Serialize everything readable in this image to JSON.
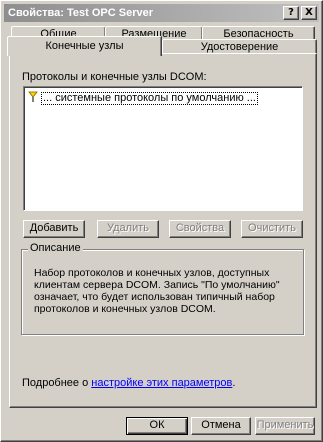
{
  "window": {
    "title": "Свойства: Test OPC Server",
    "help_button": "?",
    "close_button": "X"
  },
  "tabs": {
    "row_back": [
      "Общие",
      "Размещение",
      "Безопасность"
    ],
    "row_front": [
      "Конечные узлы",
      "Удостоверение"
    ],
    "active": "Конечные узлы"
  },
  "content": {
    "protocols_label": "Протоколы и конечные узлы DCOM:",
    "list_items": [
      "... системные протоколы по умолчанию ..."
    ],
    "buttons": {
      "add": "Добавить",
      "remove": "Удалить",
      "properties": "Свойства",
      "clear": "Очистить"
    },
    "description": {
      "legend": "Описание",
      "text": "Набор протоколов и конечных узлов, доступных клиентам сервера DCOM. Запись \"По умолчанию\" означает, что будет использован типичный набор протоколов и конечных узлов DCOM."
    },
    "more_info": {
      "prefix": "Подробнее о ",
      "link": "настройке этих параметров",
      "suffix": "."
    }
  },
  "footer": {
    "ok": "ОК",
    "cancel": "Отмена",
    "apply": "Применить"
  }
}
